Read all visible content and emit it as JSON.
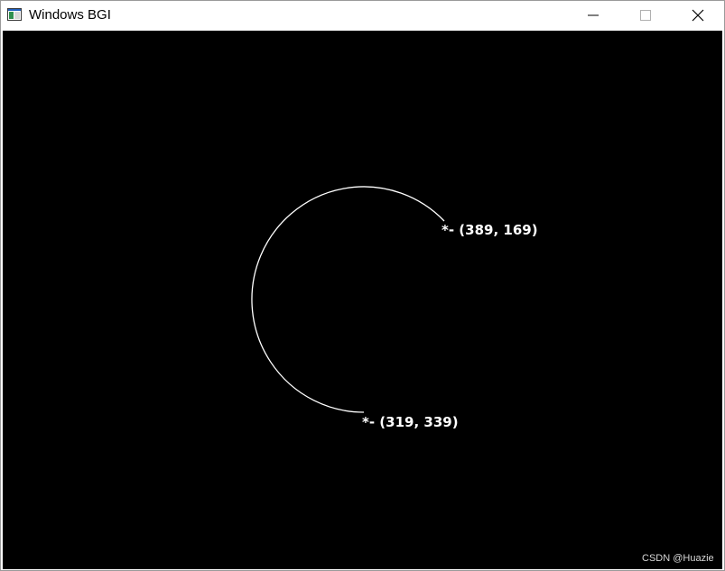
{
  "window": {
    "title": "Windows BGI",
    "app_icon": "bgi-window-icon",
    "controls": {
      "minimize_icon": "minimize-icon",
      "maximize_icon": "maximize-icon",
      "close_icon": "close-icon"
    }
  },
  "canvas": {
    "background": "#000000",
    "drawing_color": "#ffffff",
    "arc_icon": "arc-drawing",
    "labels": {
      "start": "*- (319, 339)",
      "end": "*- (389, 169)"
    }
  },
  "watermark": "CSDN @Huazie"
}
